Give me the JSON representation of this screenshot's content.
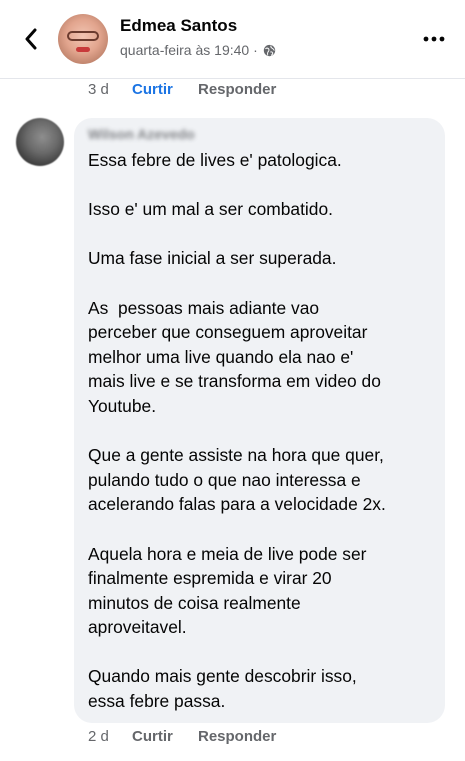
{
  "header": {
    "name": "Edmea Santos",
    "subtitle": "quarta-feira às 19:40 ·",
    "privacy_icon": "globe-icon",
    "back_icon": "chevron-left-icon",
    "more_icon": "more-horizontal-icon"
  },
  "top_actions": {
    "time": "3 d",
    "like": "Curtir",
    "reply": "Responder"
  },
  "comment": {
    "author": "Wilson Azevedo",
    "paragraphs": [
      "Essa febre de lives e' patologica.",
      "Isso e' um mal a ser combatido.",
      "Uma fase inicial a ser superada.",
      "As  pessoas mais adiante vao\nperceber que conseguem aproveitar\nmelhor uma live quando ela nao e'\nmais live e se transforma em video do\nYoutube.",
      "Que a gente assiste na hora que quer,\npulando tudo o que nao interessa e\nacelerando falas para a velocidade 2x.",
      "Aquela hora e meia de live pode ser\nfinalmente espremida e virar 20\nminutos de coisa realmente\naproveitavel.",
      "Quando mais gente descobrir isso,\nessa febre passa."
    ]
  },
  "bottom_actions": {
    "time": "2 d",
    "like": "Curtir",
    "reply": "Responder"
  },
  "colors": {
    "bubble": "#f0f2f5",
    "link_blue": "#1b74e4",
    "secondary_text": "#65676b"
  }
}
